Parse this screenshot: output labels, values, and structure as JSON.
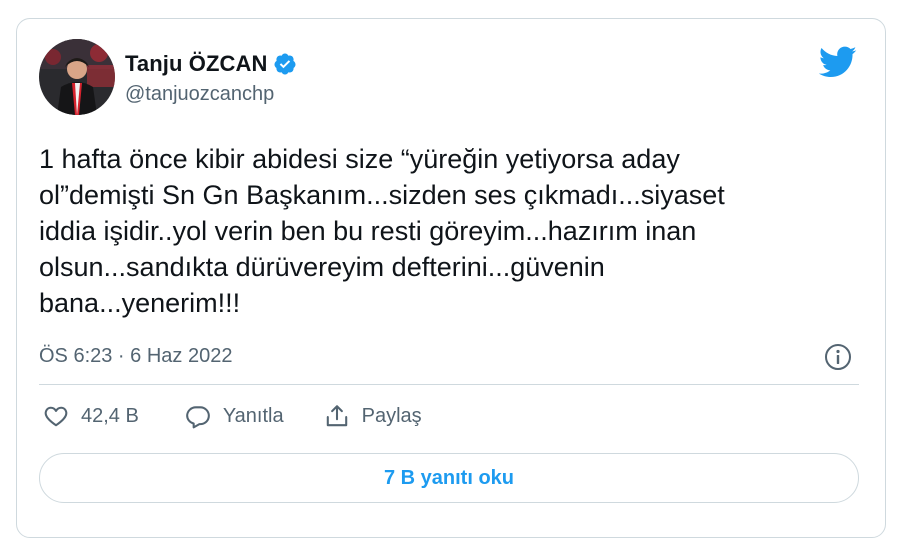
{
  "author": {
    "name": "Tanju ÖZCAN",
    "handle": "@tanjuozcanchp"
  },
  "tweet": {
    "lines": [
      "1 hafta önce kibir abidesi size “yüreğin yetiyorsa aday",
      "ol”demişti Sn Gn Başkanım...sizden ses çıkmadı...siyaset",
      "iddia işidir..yol verin ben bu resti göreyim...hazırım inan",
      "olsun...sandıkta dürüvereyim defterini...güvenin",
      "bana...yenerim!!!"
    ],
    "timestamp": "ÖS 6:23 · 6 Haz 2022"
  },
  "actions": {
    "like_count": "42,4 B",
    "reply_label": "Yanıtla",
    "share_label": "Paylaş"
  },
  "replies_button_label": "7 B yanıtı oku",
  "icons": {
    "verified": "verified-badge-icon",
    "logo": "twitter-bird-icon",
    "info": "info-icon",
    "like": "heart-icon",
    "reply": "speech-bubble-icon",
    "share": "share-icon"
  },
  "colors": {
    "accent": "#1d9bf0",
    "secondary_text": "#536471",
    "border": "#cfd9de"
  }
}
